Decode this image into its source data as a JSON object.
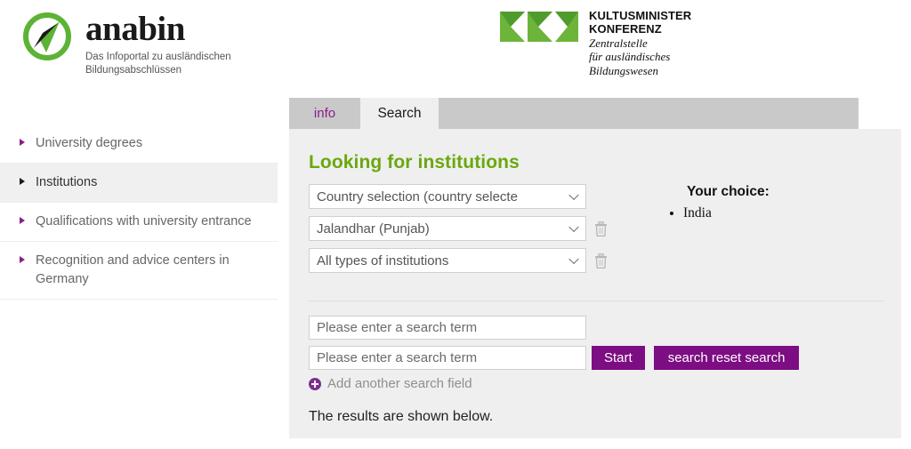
{
  "header": {
    "anabin": {
      "title": "anabin",
      "subtitle": "Das Infoportal zu ausländischen Bildungsabschlüssen",
      "logo_icon": "compass-arrow-icon",
      "accent_color": "#5cb335"
    },
    "kmk": {
      "logo_icon": "kmk-arrows-icon",
      "line1": "KULTUSMINISTER",
      "line2": "KONFERENZ",
      "line3": "Zentralstelle",
      "line4": "für ausländisches",
      "line5": "Bildungswesen",
      "accent_color": "#6cb43a"
    }
  },
  "sidebar": {
    "items": [
      {
        "label": "University degrees",
        "active": false,
        "arrow_icon": "triangle-right-icon"
      },
      {
        "label": "Institutions",
        "active": true,
        "arrow_icon": "triangle-right-icon"
      },
      {
        "label": "Qualifications with university entrance",
        "active": false,
        "arrow_icon": "triangle-right-icon"
      },
      {
        "label": "Recognition and advice centers in Germany",
        "active": false,
        "arrow_icon": "triangle-right-icon"
      }
    ]
  },
  "tabs": [
    {
      "label": "info",
      "active": false
    },
    {
      "label": "Search",
      "active": true
    }
  ],
  "main": {
    "heading": "Looking for institutions",
    "heading_color": "#6aa80f",
    "selects": [
      {
        "value": "Country selection (country selecte",
        "name": "country-select",
        "has_delete": false,
        "delete_icon": ""
      },
      {
        "value": "Jalandhar (Punjab)",
        "name": "city-select",
        "has_delete": true,
        "delete_icon": "trash-icon"
      },
      {
        "value": "All types of institutions",
        "name": "institution-type-select",
        "has_delete": true,
        "delete_icon": "trash-icon"
      }
    ],
    "search_fields": [
      {
        "placeholder": "Please enter a search term",
        "value": ""
      },
      {
        "placeholder": "Please enter a search term",
        "value": ""
      }
    ],
    "buttons": {
      "start": "Start",
      "reset": "search reset search",
      "accent_color": "#7d0d82"
    },
    "add_field": {
      "label": "Add another search field",
      "icon": "plus-circle-icon"
    },
    "results_note": "The results are shown below."
  },
  "choice": {
    "title": "Your choice:",
    "items": [
      "India"
    ]
  }
}
